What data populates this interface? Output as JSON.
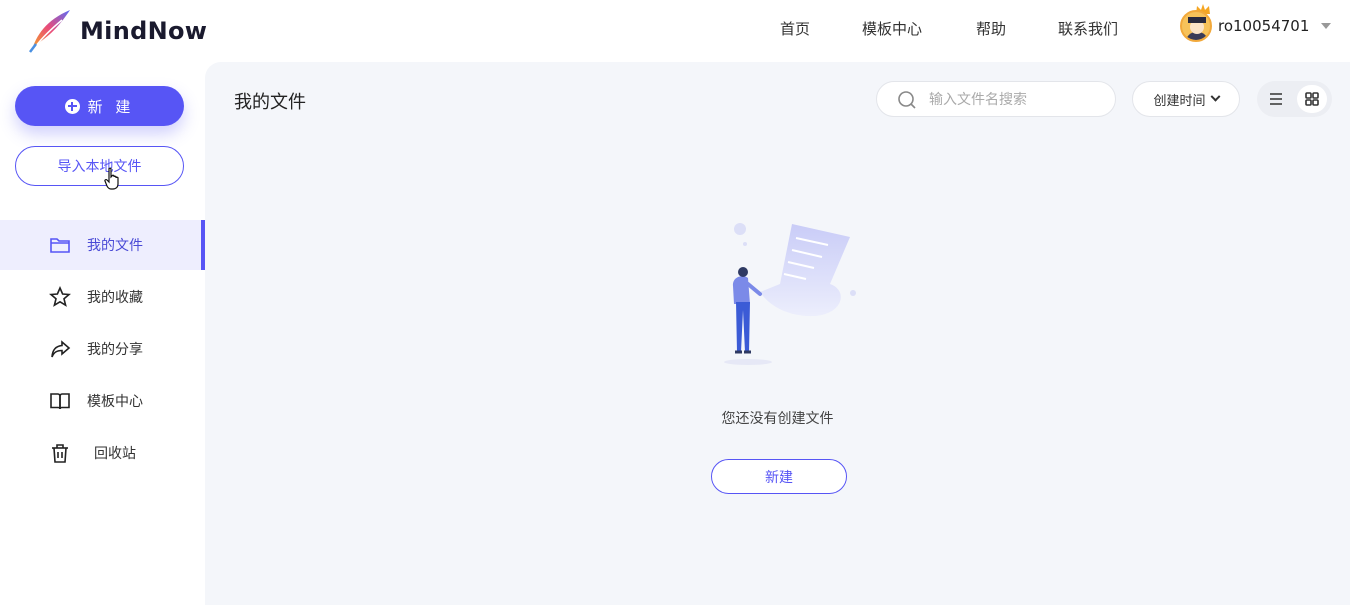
{
  "brand": {
    "name": "MindNow"
  },
  "topnav": {
    "items": [
      {
        "label": "首页"
      },
      {
        "label": "模板中心"
      },
      {
        "label": "帮助"
      },
      {
        "label": "联系我们"
      }
    ]
  },
  "user": {
    "name": "ro10054701"
  },
  "sidebar": {
    "new_label": "新 建",
    "import_label": "导入本地文件",
    "items": [
      {
        "label": "我的文件",
        "icon": "folder-icon",
        "active": true
      },
      {
        "label": "我的收藏",
        "icon": "star-icon"
      },
      {
        "label": "我的分享",
        "icon": "share-icon"
      },
      {
        "label": "模板中心",
        "icon": "book-icon"
      },
      {
        "label": "回收站",
        "icon": "trash-icon"
      }
    ]
  },
  "main": {
    "title": "我的文件",
    "search_placeholder": "输入文件名搜索",
    "sort_label": "创建时间",
    "empty_text": "您还没有创建文件",
    "empty_new_label": "新建"
  },
  "colors": {
    "accent": "#5755f5",
    "main_bg": "#f4f6fa",
    "active_bg": "#eeeefe"
  }
}
